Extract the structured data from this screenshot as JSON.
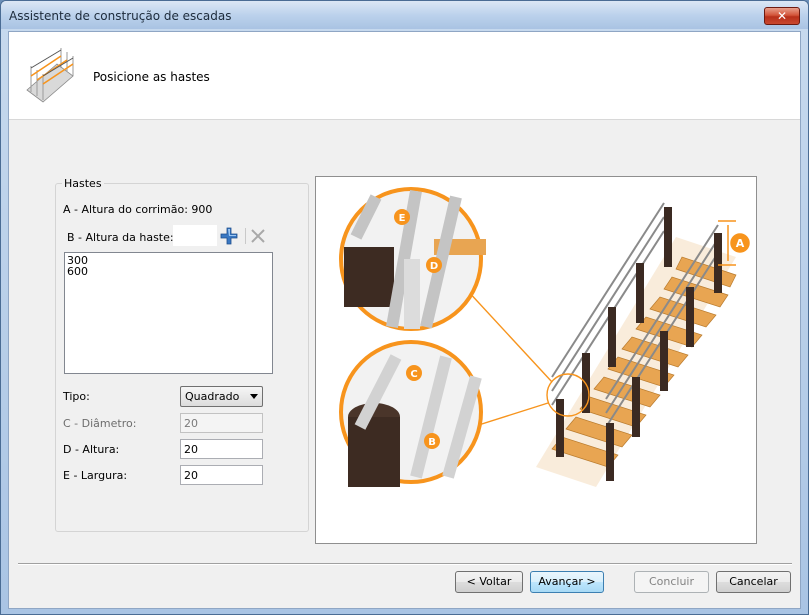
{
  "window": {
    "title": "Assistente de construção de escadas",
    "close_glyph": "✕"
  },
  "header": {
    "title": "Posicione as hastes",
    "icon": "staircase-icon"
  },
  "group": {
    "legend": "Hastes",
    "rail_height_label": "A - Altura do corrimão: 900",
    "haste_height_label": "B - Altura da haste:",
    "haste_input_value": "",
    "add_icon": "plus-icon",
    "delete_icon": "x-icon",
    "list_values": [
      "300",
      "600"
    ],
    "tipo_label": "Tipo:",
    "tipo_value": "Quadrado",
    "diametro_label": "C - Diâmetro:",
    "diametro_value": "20",
    "altura_label": "D - Altura:",
    "altura_value": "20",
    "largura_label": "E - Largura:",
    "largura_value": "20"
  },
  "illustration": {
    "labels": [
      "A",
      "B",
      "C",
      "D",
      "E"
    ],
    "accent_color": "#f7941d"
  },
  "footer": {
    "back_label": "< Voltar",
    "next_label": "Avançar >",
    "finish_label": "Concluir",
    "cancel_label": "Cancelar"
  }
}
